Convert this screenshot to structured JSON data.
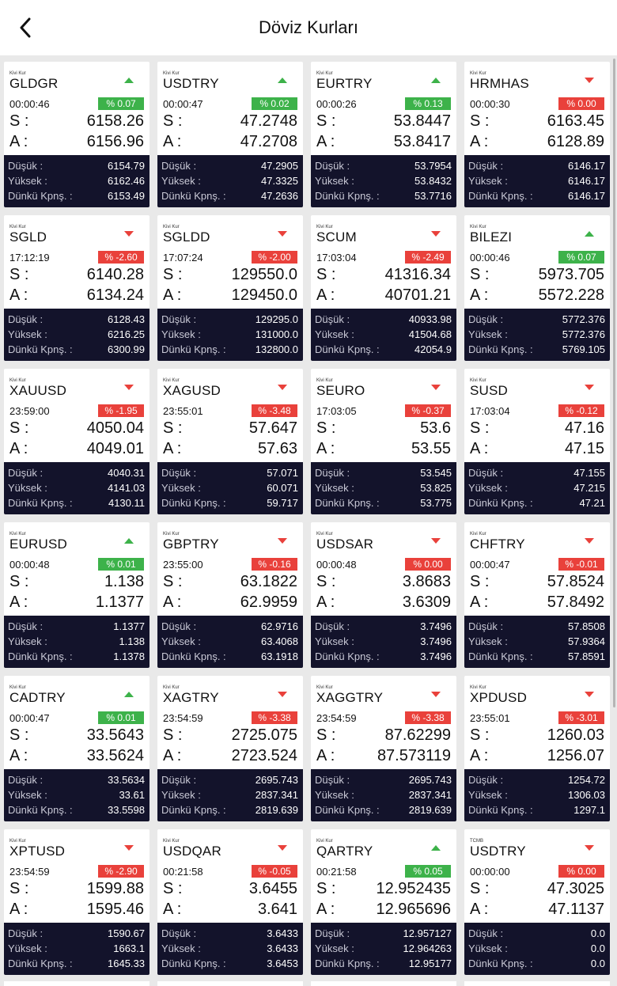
{
  "header": {
    "title": "Döviz Kurları",
    "back_icon": "chevron-left-icon"
  },
  "labels": {
    "sell": "S :",
    "buy": "A :",
    "low": "Düşük :",
    "high": "Yüksek :",
    "prev_close": "Dünkü Kpnş. :"
  },
  "colors": {
    "up": "#3db24a",
    "down": "#e9413b",
    "panel": "#13132b"
  },
  "rates": [
    {
      "source": "Kivi Kur",
      "code": "GLDGR",
      "trend": "up",
      "time": "00:00:46",
      "change": "% 0.07",
      "sell": "6158.26",
      "buy": "6156.96",
      "low": "6154.79",
      "high": "6162.46",
      "prev_close": "6153.49"
    },
    {
      "source": "Kivi Kur",
      "code": "USDTRY",
      "trend": "up",
      "time": "00:00:47",
      "change": "% 0.02",
      "sell": "47.2748",
      "buy": "47.2708",
      "low": "47.2905",
      "high": "47.3325",
      "prev_close": "47.2636"
    },
    {
      "source": "Kivi Kur",
      "code": "EURTRY",
      "trend": "up",
      "time": "00:00:26",
      "change": "% 0.13",
      "sell": "53.8447",
      "buy": "53.8417",
      "low": "53.7954",
      "high": "53.8432",
      "prev_close": "53.7716"
    },
    {
      "source": "Kivi Kur",
      "code": "HRMHAS",
      "trend": "down",
      "time": "00:00:30",
      "change": "% 0.00",
      "sell": "6163.45",
      "buy": "6128.89",
      "low": "6146.17",
      "high": "6146.17",
      "prev_close": "6146.17"
    },
    {
      "source": "Kivi Kur",
      "code": "SGLD",
      "trend": "down",
      "time": "17:12:19",
      "change": "% -2.60",
      "sell": "6140.28",
      "buy": "6134.24",
      "low": "6128.43",
      "high": "6216.25",
      "prev_close": "6300.99"
    },
    {
      "source": "Kivi Kur",
      "code": "SGLDD",
      "trend": "down",
      "time": "17:07:24",
      "change": "% -2.00",
      "sell": "129550.0",
      "buy": "129450.0",
      "low": "129295.0",
      "high": "131000.0",
      "prev_close": "132800.0"
    },
    {
      "source": "Kivi Kur",
      "code": "SCUM",
      "trend": "down",
      "time": "17:03:04",
      "change": "% -2.49",
      "sell": "41316.34",
      "buy": "40701.21",
      "low": "40933.98",
      "high": "41504.68",
      "prev_close": "42054.9"
    },
    {
      "source": "Kivi Kur",
      "code": "BILEZI",
      "trend": "up",
      "time": "00:00:46",
      "change": "% 0.07",
      "sell": "5973.705",
      "buy": "5572.228",
      "low": "5772.376",
      "high": "5772.376",
      "prev_close": "5769.105"
    },
    {
      "source": "Kivi Kur",
      "code": "XAUUSD",
      "trend": "down",
      "time": "23:59:00",
      "change": "% -1.95",
      "sell": "4050.04",
      "buy": "4049.01",
      "low": "4040.31",
      "high": "4141.03",
      "prev_close": "4130.11"
    },
    {
      "source": "Kivi Kur",
      "code": "XAGUSD",
      "trend": "down",
      "time": "23:55:01",
      "change": "% -3.48",
      "sell": "57.647",
      "buy": "57.63",
      "low": "57.071",
      "high": "60.071",
      "prev_close": "59.717"
    },
    {
      "source": "Kivi Kur",
      "code": "SEURO",
      "trend": "down",
      "time": "17:03:05",
      "change": "% -0.37",
      "sell": "53.6",
      "buy": "53.55",
      "low": "53.545",
      "high": "53.825",
      "prev_close": "53.775"
    },
    {
      "source": "Kivi Kur",
      "code": "SUSD",
      "trend": "down",
      "time": "17:03:04",
      "change": "% -0.12",
      "sell": "47.16",
      "buy": "47.15",
      "low": "47.155",
      "high": "47.215",
      "prev_close": "47.21"
    },
    {
      "source": "Kivi Kur",
      "code": "EURUSD",
      "trend": "up",
      "time": "00:00:48",
      "change": "% 0.01",
      "sell": "1.138",
      "buy": "1.1377",
      "low": "1.1377",
      "high": "1.138",
      "prev_close": "1.1378"
    },
    {
      "source": "Kivi Kur",
      "code": "GBPTRY",
      "trend": "down",
      "time": "23:55:00",
      "change": "% -0.16",
      "sell": "63.1822",
      "buy": "62.9959",
      "low": "62.9716",
      "high": "63.4068",
      "prev_close": "63.1918"
    },
    {
      "source": "Kivi Kur",
      "code": "USDSAR",
      "trend": "down",
      "time": "00:00:48",
      "change": "% 0.00",
      "sell": "3.8683",
      "buy": "3.6309",
      "low": "3.7496",
      "high": "3.7496",
      "prev_close": "3.7496"
    },
    {
      "source": "Kivi Kur",
      "code": "CHFTRY",
      "trend": "down",
      "time": "00:00:47",
      "change": "% -0.01",
      "sell": "57.8524",
      "buy": "57.8492",
      "low": "57.8508",
      "high": "57.9364",
      "prev_close": "57.8591"
    },
    {
      "source": "Kivi Kur",
      "code": "CADTRY",
      "trend": "up",
      "time": "00:00:47",
      "change": "% 0.01",
      "sell": "33.5643",
      "buy": "33.5624",
      "low": "33.5634",
      "high": "33.61",
      "prev_close": "33.5598"
    },
    {
      "source": "Kivi Kur",
      "code": "XAGTRY",
      "trend": "down",
      "time": "23:54:59",
      "change": "% -3.38",
      "sell": "2725.075",
      "buy": "2723.524",
      "low": "2695.743",
      "high": "2837.341",
      "prev_close": "2819.639"
    },
    {
      "source": "Kivi Kur",
      "code": "XAGGTRY",
      "trend": "down",
      "time": "23:54:59",
      "change": "% -3.38",
      "sell": "87.62299",
      "buy": "87.573119",
      "low": "2695.743",
      "high": "2837.341",
      "prev_close": "2819.639"
    },
    {
      "source": "Kivi Kur",
      "code": "XPDUSD",
      "trend": "down",
      "time": "23:55:01",
      "change": "% -3.01",
      "sell": "1260.03",
      "buy": "1256.07",
      "low": "1254.72",
      "high": "1306.03",
      "prev_close": "1297.1"
    },
    {
      "source": "Kivi Kur",
      "code": "XPTUSD",
      "trend": "down",
      "time": "23:54:59",
      "change": "% -2.90",
      "sell": "1599.88",
      "buy": "1595.46",
      "low": "1590.67",
      "high": "1663.1",
      "prev_close": "1645.33"
    },
    {
      "source": "Kivi Kur",
      "code": "USDQAR",
      "trend": "down",
      "time": "00:21:58",
      "change": "% -0.05",
      "sell": "3.6455",
      "buy": "3.641",
      "low": "3.6433",
      "high": "3.6433",
      "prev_close": "3.6453"
    },
    {
      "source": "Kivi Kur",
      "code": "QARTRY",
      "trend": "up",
      "time": "00:21:58",
      "change": "% 0.05",
      "sell": "12.952435",
      "buy": "12.965696",
      "low": "12.957127",
      "high": "12.964263",
      "prev_close": "12.95177"
    },
    {
      "source": "TCMB",
      "code": "USDTRY",
      "trend": "down",
      "time": "00:00:00",
      "change": "% 0.00",
      "sell": "47.3025",
      "buy": "47.1137",
      "low": "0.0",
      "high": "0.0",
      "prev_close": "0.0"
    }
  ]
}
